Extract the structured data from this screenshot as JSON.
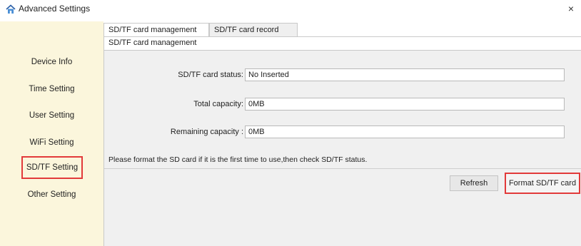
{
  "window": {
    "title": "Advanced Settings",
    "close": "×"
  },
  "sidebar": {
    "items": [
      {
        "label": "Device Info"
      },
      {
        "label": "Time Setting"
      },
      {
        "label": "User Setting"
      },
      {
        "label": "WiFi Setting"
      },
      {
        "label": "SD/TF Setting",
        "active": true
      },
      {
        "label": "Other Setting"
      }
    ]
  },
  "tabs": [
    {
      "label": "SD/TF card management",
      "active": true
    },
    {
      "label": "SD/TF card record"
    }
  ],
  "panel": {
    "header": "SD/TF card management",
    "fields": {
      "status": {
        "label": "SD/TF card status:",
        "value": "No Inserted"
      },
      "total": {
        "label": "Total capacity:",
        "value": "0MB"
      },
      "remaining": {
        "label": "Remaining capacity :",
        "value": "0MB"
      }
    },
    "hint": "Please format the SD card if it is the first time to use,then check SD/TF status.",
    "buttons": {
      "refresh": "Refresh",
      "format": "Format SD/TF card"
    }
  },
  "colors": {
    "sidebar_bg": "#fbf6dc",
    "highlight": "#e23a3a",
    "panel_bg": "#f0f0f0"
  }
}
